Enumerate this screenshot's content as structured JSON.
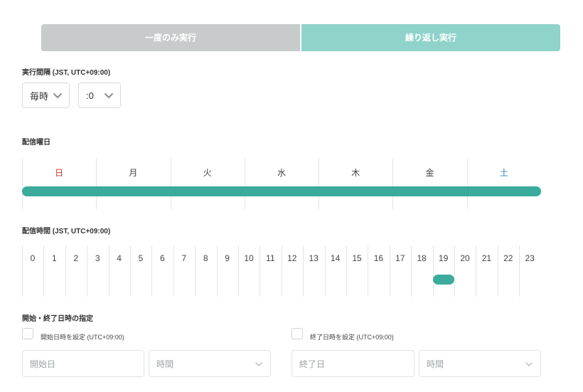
{
  "mode": {
    "once_label": "一度のみ実行",
    "repeat_label": "繰り返し実行"
  },
  "interval": {
    "label": "実行間隔 (JST, UTC+09:00)",
    "unit_value": "毎時",
    "minute_value": ":0"
  },
  "weekdays": {
    "label": "配信曜日",
    "days": [
      "日",
      "月",
      "火",
      "水",
      "木",
      "金",
      "土"
    ],
    "selected_all": true,
    "colors": {
      "sunday": "#c0392b",
      "saturday": "#2e86c1",
      "weekday": "#444444",
      "accent": "#3aab9c"
    }
  },
  "hours": {
    "label": "配信時間 (JST, UTC+09:00)",
    "values": [
      "0",
      "1",
      "2",
      "3",
      "4",
      "5",
      "6",
      "7",
      "8",
      "9",
      "10",
      "11",
      "12",
      "13",
      "14",
      "15",
      "16",
      "17",
      "18",
      "19",
      "20",
      "21",
      "22",
      "23"
    ],
    "selected": [
      19
    ]
  },
  "range": {
    "label": "開始・終了日時の指定",
    "start_check_label": "開始日時を設定 (UTC+09:00)",
    "end_check_label": "終了日時を設定 (UTC+09:00)",
    "start_date_placeholder": "開始日",
    "start_time_value": "時間",
    "end_date_placeholder": "終了日",
    "end_time_value": "時間"
  }
}
